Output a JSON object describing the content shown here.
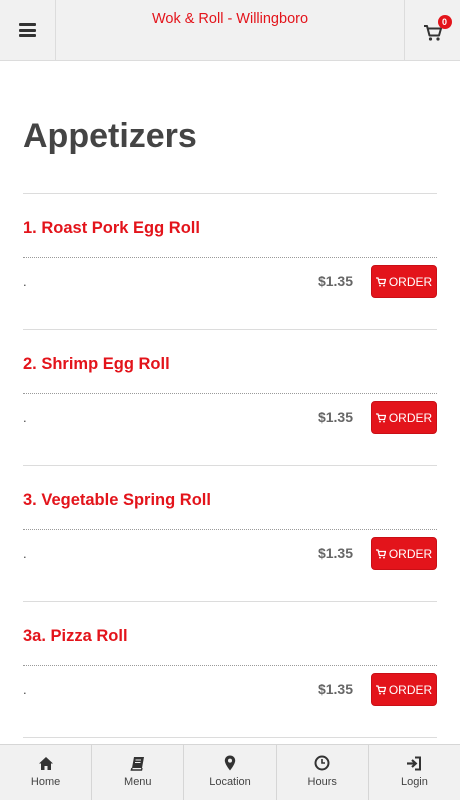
{
  "header": {
    "title": "Wok & Roll - Willingboro",
    "menu_icon": "hamburger-icon",
    "cart_icon": "cart-icon",
    "cart_count": "0"
  },
  "category": {
    "title": "Appetizers"
  },
  "items": [
    {
      "name": "1. Roast Pork Egg Roll",
      "description": ".",
      "price": "$1.35",
      "order_label": "ORDER"
    },
    {
      "name": "2. Shrimp Egg Roll",
      "description": ".",
      "price": "$1.35",
      "order_label": "ORDER"
    },
    {
      "name": "3. Vegetable Spring Roll",
      "description": ".",
      "price": "$1.35",
      "order_label": "ORDER"
    },
    {
      "name": "3a. Pizza Roll",
      "description": ".",
      "price": "$1.35",
      "order_label": "ORDER"
    }
  ],
  "bottom_nav": [
    {
      "label": "Home",
      "icon": "home-icon"
    },
    {
      "label": "Menu",
      "icon": "book-icon"
    },
    {
      "label": "Location",
      "icon": "map-pin-icon"
    },
    {
      "label": "Hours",
      "icon": "clock-icon"
    },
    {
      "label": "Login",
      "icon": "login-icon"
    }
  ],
  "colors": {
    "accent": "#e3141b",
    "bar_background": "#f1f1f1"
  }
}
